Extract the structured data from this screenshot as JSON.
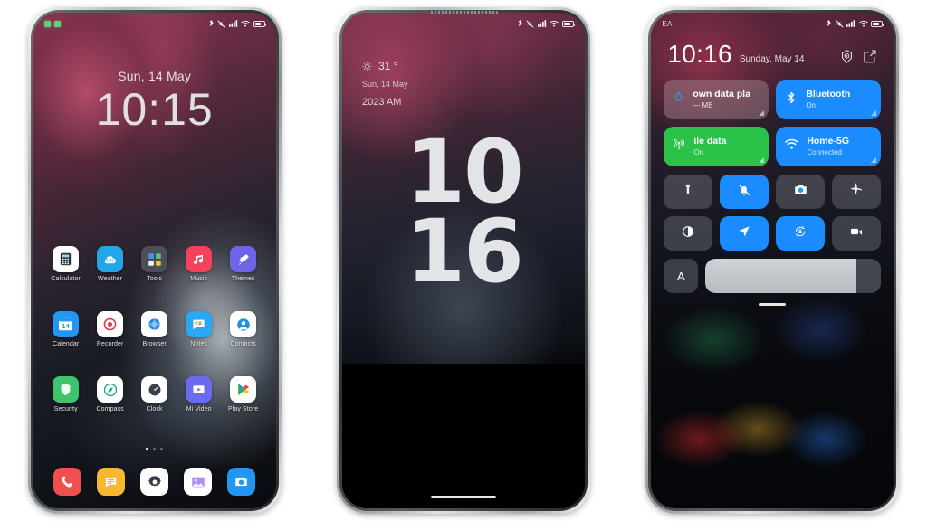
{
  "scene": {
    "title": "MIUI Theme Preview - Three Phones",
    "background": "#ffffff"
  },
  "phone1": {
    "label": "home-screen",
    "status_bar": {
      "indicator_1": "green-square",
      "indicator_2": "green-square",
      "icons": [
        "bluetooth-icon",
        "mute-icon",
        "signal-icon",
        "wifi-icon",
        "battery-icon"
      ]
    },
    "lock": {
      "date": "Sun, 14 May",
      "time": "10:15"
    },
    "apps_row1": [
      {
        "label": "Calculator",
        "icon": "calculator-icon",
        "bg": "#ffffff",
        "fg": "#2c2f36"
      },
      {
        "label": "Weather",
        "icon": "weather-icon",
        "bg": "#22a6e8",
        "fg": "#ffffff"
      },
      {
        "label": "Tools",
        "icon": "tools-folder-icon",
        "bg": "#4a4f58",
        "fg": "#ffffff"
      },
      {
        "label": "Music",
        "icon": "music-icon",
        "bg": "#f6415c",
        "fg": "#ffffff"
      },
      {
        "label": "Themes",
        "icon": "themes-icon",
        "bg": "#6f63e8",
        "fg": "#ffffff"
      }
    ],
    "apps_row2": [
      {
        "label": "Calendar",
        "icon": "calendar-icon",
        "bg": "#2196f3",
        "fg": "#ffffff",
        "badge": "14"
      },
      {
        "label": "Recorder",
        "icon": "recorder-icon",
        "bg": "#ffffff",
        "fg": "#f0324b"
      },
      {
        "label": "Browser",
        "icon": "browser-icon",
        "bg": "#ffffff",
        "fg": "#1a7ae8"
      },
      {
        "label": "Notes",
        "icon": "notes-icon",
        "bg": "#29a9f5",
        "fg": "#ffffff"
      },
      {
        "label": "Contacts",
        "icon": "contacts-icon",
        "bg": "#ffffff",
        "fg": "#1f8fe0"
      }
    ],
    "apps_row3": [
      {
        "label": "Security",
        "icon": "shield-icon",
        "bg": "#3ec46d",
        "fg": "#ffffff"
      },
      {
        "label": "Compass",
        "icon": "compass-icon",
        "bg": "#ffffff",
        "fg": "#14a38b"
      },
      {
        "label": "Clock",
        "icon": "clock-icon",
        "bg": "#ffffff",
        "fg": "#3b4049"
      },
      {
        "label": "Mi Video",
        "icon": "video-play-icon",
        "bg": "#6b6bf0",
        "fg": "#ffffff"
      },
      {
        "label": "Play Store",
        "icon": "play-store-icon",
        "bg": "#ffffff",
        "fg": "#34a853"
      }
    ],
    "page_dots": {
      "count": 3,
      "active": 1
    },
    "dock": [
      {
        "label": "Phone",
        "icon": "phone-icon",
        "bg": "#ef4f4f",
        "fg": "#ffffff"
      },
      {
        "label": "Messages",
        "icon": "message-icon",
        "bg": "#f7b731",
        "fg": "#ffffff"
      },
      {
        "label": "Settings",
        "icon": "gear-icon",
        "bg": "#ffffff",
        "fg": "#343a42"
      },
      {
        "label": "Gallery",
        "icon": "gallery-icon",
        "bg": "#ffffff",
        "fg": "#9a6bf0"
      },
      {
        "label": "Camera",
        "icon": "camera-icon",
        "bg": "#2196f3",
        "fg": "#ffffff"
      }
    ]
  },
  "phone2": {
    "label": "lock-screen",
    "status_bar": {
      "icons": [
        "bluetooth-icon",
        "mute-icon",
        "signal-icon",
        "wifi-icon",
        "battery-icon"
      ]
    },
    "weather": {
      "icon": "sun-icon",
      "temperature": "31 °"
    },
    "date": "Sun, 14 May",
    "year_meridiem": "2023 AM",
    "clock_line1": "10",
    "clock_line2": "16"
  },
  "phone3": {
    "label": "control-center",
    "status_bar": {
      "carrier": "EA",
      "icons": [
        "bluetooth-icon",
        "mute-icon",
        "signal-icon",
        "wifi-icon",
        "battery-icon"
      ]
    },
    "header": {
      "time": "10:16",
      "date": "Sunday, May 14",
      "settings_icon": "gear-icon",
      "edit_icon": "edit-icon"
    },
    "tiles": [
      {
        "title": "own data pla",
        "sub": "— MB",
        "icon": "data-drop-icon",
        "bg": "rgba(168,140,148,0.45)",
        "state": "off"
      },
      {
        "title": "Bluetooth",
        "sub": "On",
        "icon": "bluetooth-icon",
        "bg": "#1a8cff",
        "state": "on"
      },
      {
        "title": "ile data",
        "sub": "On",
        "icon": "cell-tower-icon",
        "bg": "#2bc24a",
        "state": "on"
      },
      {
        "title": "Home-5G",
        "sub": "Connected",
        "icon": "wifi-icon",
        "bg": "#1a8cff",
        "state": "on"
      }
    ],
    "toggles": [
      {
        "icon": "flashlight-icon",
        "state": "off"
      },
      {
        "icon": "silent-bell-icon",
        "state": "on"
      },
      {
        "icon": "camera-icon",
        "state": "off"
      },
      {
        "icon": "airplane-icon",
        "state": "off"
      },
      {
        "icon": "dark-mode-icon",
        "state": "off"
      },
      {
        "icon": "location-arrow-icon",
        "state": "on"
      },
      {
        "icon": "rotation-lock-icon",
        "state": "on"
      },
      {
        "icon": "screen-record-icon",
        "state": "off"
      }
    ],
    "brightness": {
      "auto_label": "A",
      "level_percent": 86
    },
    "grabber": "drag-handle"
  }
}
